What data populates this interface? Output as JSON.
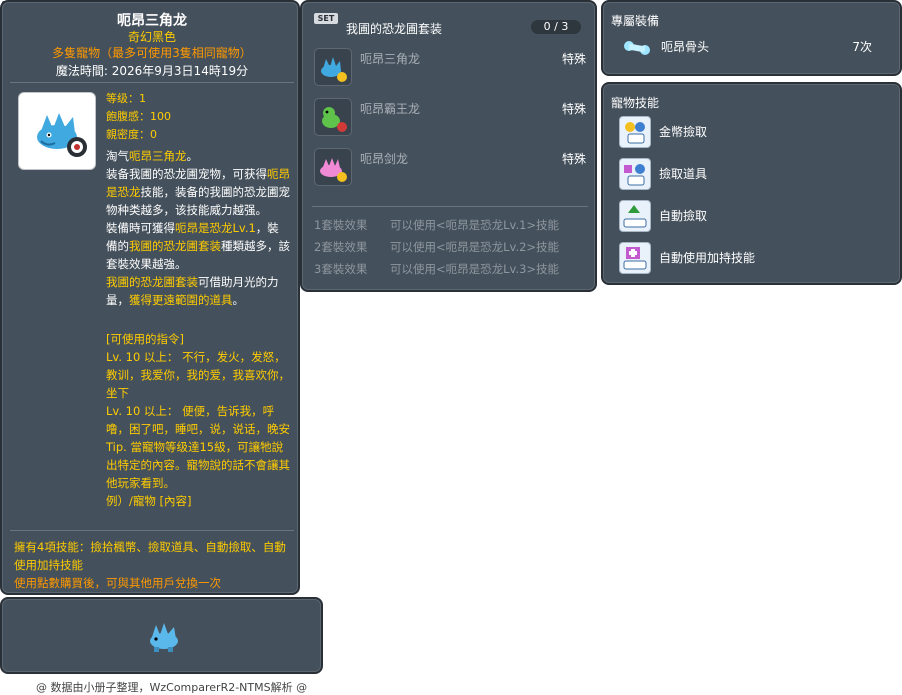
{
  "item_id": "05002806",
  "pet": {
    "name": "呃昂三角龙",
    "subtitle": "奇幻黑色",
    "multi_pet": "多隻寵物（最多可使用3隻相同寵物）",
    "magic_time": "魔法時間: 2026年9月3日14時19分",
    "stats": {
      "level": "等级：1",
      "fullness": "飽腹感：100",
      "closeness": "親密度：0"
    },
    "desc": [
      {
        "t": "淘气",
        "h": "呃昂三角龙",
        "e": "。"
      },
      {
        "t": "装备我圃的恐龙圃宠物，可获得",
        "h": "呃昂是恐龙",
        "e": "技能，装备的我圃的恐龙圃宠物种类越多，该技能威力越强。"
      },
      {
        "t": "裝備時可獲得",
        "h": "呃昂是恐龙Lv.1",
        "e": "，裝備的",
        "h2": "我圃的恐龙圃套装",
        "e2": "種類越多，該套裝效果越強。"
      },
      {
        "t": "",
        "h": "我圃的恐龙圃套装",
        "e": "可借助月光的力量，",
        "h2": "獲得更遠範圍的道具",
        "e2": "。"
      }
    ],
    "commands": [
      "[可使用的指令]",
      "Lv. 10 以上： 不行，发火，发怒，教训，我爱你，我的爱，我喜欢你，坐下",
      "Lv. 10 以上： 便便，告诉我，呼噜，困了吧，睡吧，说，说话，晚安",
      "Tip. 當寵物等级達15級，可讓牠說出特定的內容。寵物說的話不會讓其他玩家看到。",
      "例）/寵物 [內容]"
    ],
    "skills_summary": "擁有4項技能：撿拾楓幣、撿取道具、自動撿取、自動使用加持技能",
    "exchange_note": "使用點數購買後，可與其他用戶兌換一次"
  },
  "set": {
    "badge": "SET",
    "name": "我圃的恐龙圃套装",
    "count": "0 / 3",
    "items": [
      {
        "name": "呃昂三角龙",
        "type": "特殊"
      },
      {
        "name": "呃昂霸王龙",
        "type": "特殊"
      },
      {
        "name": "呃昂剑龙",
        "type": "特殊"
      }
    ],
    "effects": [
      {
        "label": "1套裝效果",
        "value": "可以使用<呃昂是恐龙Lv.1>技能"
      },
      {
        "label": "2套裝效果",
        "value": "可以使用<呃昂是恐龙Lv.2>技能"
      },
      {
        "label": "3套裝效果",
        "value": "可以使用<呃昂是恐龙Lv.3>技能"
      }
    ]
  },
  "exclusive": {
    "title": "專屬裝備",
    "item": "呃昂骨头",
    "count": "7次"
  },
  "pet_skills": {
    "title": "寵物技能",
    "items": [
      "金幣撿取",
      "撿取道具",
      "自動撿取",
      "自動使用加持技能"
    ]
  },
  "footer": "@ 数据由小册子整理，WzComparerR2-NTMS解析 @",
  "colors": {
    "panel_bg": "#44505b",
    "highlight": "#ffcc00",
    "orange": "#ff9900"
  }
}
